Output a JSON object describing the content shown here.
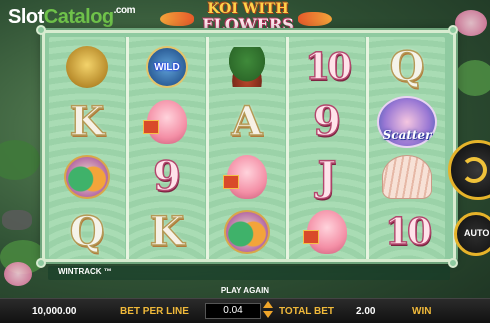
{
  "watermark": {
    "part1": "Slot",
    "part2": "Catalog",
    "part3": ".com"
  },
  "game_logo": {
    "line1": "KOI WITH",
    "line2": "FLOWERS"
  },
  "reels": [
    [
      "frog",
      "K",
      "birds",
      "Q"
    ],
    [
      "wild",
      "lotus",
      "9",
      "K"
    ],
    [
      "bonsai",
      "A",
      "lotus",
      "birds"
    ],
    [
      "10",
      "9",
      "J",
      "lotus"
    ],
    [
      "Q",
      "scatter",
      "shell",
      "10"
    ]
  ],
  "wild_label": "WILD",
  "scatter_label": "Scatter",
  "wintrack_label": "WINTRACK ™",
  "play_again_label": "PLAY AGAIN",
  "bar": {
    "balance": "10,000.00",
    "bet_per_line_label": "BET PER LINE",
    "bet_per_line": "0.04",
    "total_bet_label": "TOTAL BET",
    "total_bet": "2.00",
    "win_label": "WIN"
  },
  "auto_label": "AUTO",
  "colors": {
    "accent": "#f0b93a",
    "reel_bg": "#8fcaa0",
    "bar_bg": "#1a1a1a"
  }
}
